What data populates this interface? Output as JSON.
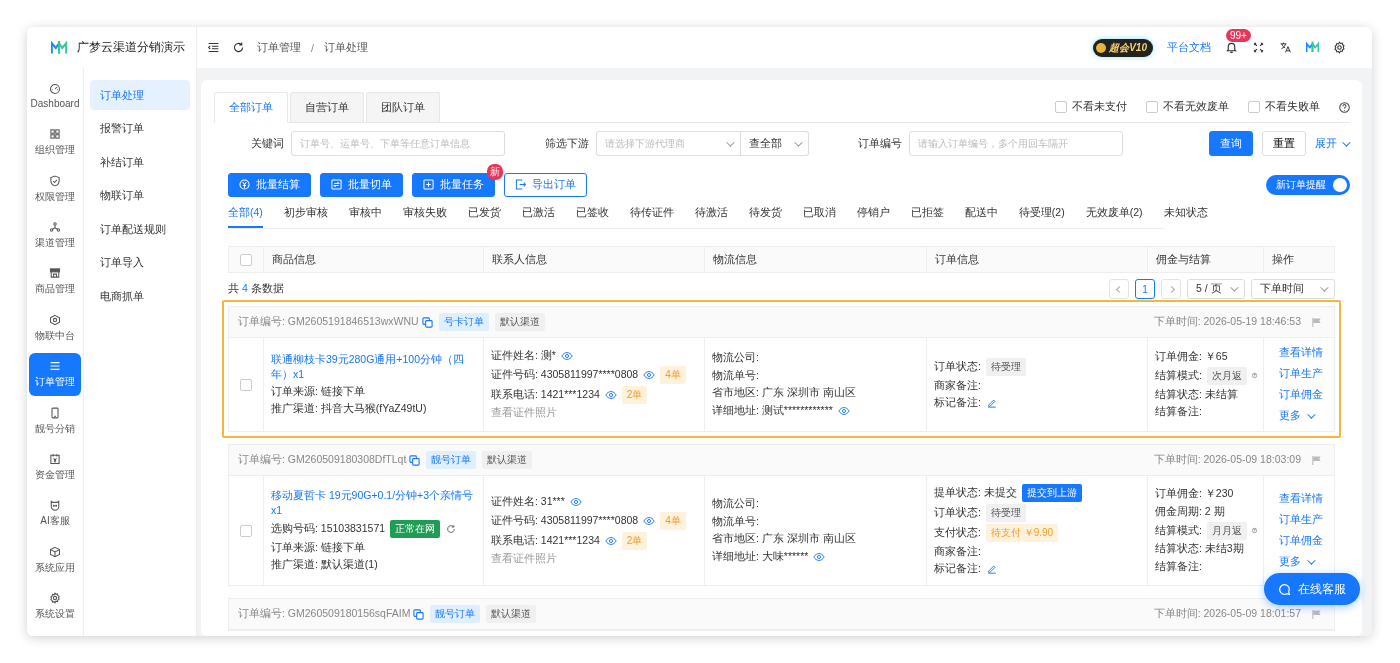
{
  "app": {
    "name": "广梦云渠道分销演示"
  },
  "header": {
    "breadcrumb": [
      "订单管理",
      "订单处理"
    ],
    "breadcrumb_separator": "/",
    "vip_badge": "超会V10",
    "docs_link": "平台文档",
    "notification_count": "99+"
  },
  "rail": [
    {
      "label": "Dashboard",
      "selected": false
    },
    {
      "label": "组织管理",
      "selected": false
    },
    {
      "label": "权限管理",
      "selected": false
    },
    {
      "label": "渠道管理",
      "selected": false
    },
    {
      "label": "商品管理",
      "selected": false
    },
    {
      "label": "物联中台",
      "selected": false
    },
    {
      "label": "订单管理",
      "selected": true
    },
    {
      "label": "靓号分销",
      "selected": false
    },
    {
      "label": "资金管理",
      "selected": false
    },
    {
      "label": "AI客服",
      "selected": false
    },
    {
      "label": "系统应用",
      "selected": false
    },
    {
      "label": "系统设置",
      "selected": false
    }
  ],
  "submenu": [
    {
      "label": "订单处理",
      "selected": true
    },
    {
      "label": "报警订单",
      "selected": false
    },
    {
      "label": "补结订单",
      "selected": false
    },
    {
      "label": "物联订单",
      "selected": false
    },
    {
      "label": "订单配送规则",
      "selected": false
    },
    {
      "label": "订单导入",
      "selected": false
    },
    {
      "label": "电商抓单",
      "selected": false
    }
  ],
  "order_tabs": [
    {
      "label": "全部订单",
      "selected": true
    },
    {
      "label": "自营订单",
      "selected": false
    },
    {
      "label": "团队订单",
      "selected": false
    }
  ],
  "hide_filters": [
    {
      "label": "不看未支付",
      "checked": false
    },
    {
      "label": "不看无效废单",
      "checked": false
    },
    {
      "label": "不看失败单",
      "checked": false
    }
  ],
  "search": {
    "keyword_label": "关键词",
    "keyword_placeholder": "订单号、运单号、下单等任意订单信息",
    "downstream_label": "筛选下游",
    "downstream_placeholder": "请选择下游代理商",
    "scope": "查全部",
    "order_no_label": "订单编号",
    "order_no_placeholder": "请输入订单编号，多个用回车隔开",
    "query": "查询",
    "reset": "重置",
    "expand": "展开"
  },
  "actions": [
    {
      "label": "批量结算",
      "kind": "primary"
    },
    {
      "label": "批量切单",
      "kind": "primary"
    },
    {
      "label": "批量任务",
      "kind": "primary",
      "badge": "新"
    },
    {
      "label": "导出订单",
      "kind": "outline"
    }
  ],
  "new_order_alert": {
    "label": "新订单提醒",
    "on": true
  },
  "status_tabs": [
    {
      "label": "全部(4)",
      "selected": true
    },
    {
      "label": "初步审核",
      "selected": false
    },
    {
      "label": "审核中",
      "selected": false
    },
    {
      "label": "审核失败",
      "selected": false
    },
    {
      "label": "已发货",
      "selected": false
    },
    {
      "label": "已激活",
      "selected": false
    },
    {
      "label": "已签收",
      "selected": false
    },
    {
      "label": "待传证件",
      "selected": false
    },
    {
      "label": "待激活",
      "selected": false
    },
    {
      "label": "待发货",
      "selected": false
    },
    {
      "label": "已取消",
      "selected": false
    },
    {
      "label": "停销户",
      "selected": false
    },
    {
      "label": "已拒签",
      "selected": false
    },
    {
      "label": "配送中",
      "selected": false
    },
    {
      "label": "待受理(2)",
      "selected": false
    },
    {
      "label": "无效废单(2)",
      "selected": false
    },
    {
      "label": "未知状态",
      "selected": false
    }
  ],
  "table": {
    "columns": [
      "商品信息",
      "联系人信息",
      "物流信息",
      "订单信息",
      "佣金与结算",
      "操作"
    ],
    "select_all_checked": false,
    "total_prefix": "共",
    "total_count": "4",
    "total_suffix": "条数据",
    "pages": [
      {
        "label": "1",
        "selected": true
      }
    ],
    "page_size": "5 / 页",
    "sort": "下单时间"
  },
  "orders": [
    {
      "selected": true,
      "checked": false,
      "number": "订单编号: GM2605191846513wxWNU",
      "type_tag": "号卡订单",
      "channel_tag": "默认渠道",
      "time": "下单时间: 2026-05-19 18:46:53",
      "product_title": "联通柳枝卡39元280G通用+100分钟（四年）x1",
      "product_lines": [
        {
          "text": "订单来源: 链接下单"
        },
        {
          "text": "推广渠道: 抖音大马猴(fYaZ49tU)"
        }
      ],
      "contact_lines": [
        {
          "text": "证件姓名: 测*",
          "masked": true
        },
        {
          "text": "证件号码: 4305811997****0808",
          "masked": true,
          "count": "4单"
        },
        {
          "text": "联系电话: 1421***1234",
          "masked": true,
          "count": "2单"
        },
        {
          "text": "查看证件照片",
          "kind": "muted"
        }
      ],
      "logistics_lines": [
        {
          "text": "物流公司:"
        },
        {
          "text": "物流单号:"
        },
        {
          "text": "省市地区: 广东 深圳市 南山区"
        },
        {
          "text": "详细地址: 测试************",
          "masked": true
        }
      ],
      "order_lines": [
        {
          "text": "订单状态:",
          "tag": {
            "text": "待受理",
            "kind": "grey"
          }
        },
        {
          "text": "商家备注:"
        },
        {
          "text": "标记备注:",
          "editable": true
        }
      ],
      "commission_lines": [
        {
          "text": "订单佣金: ￥65"
        },
        {
          "text": "结算模式:",
          "tag": {
            "text": "次月返",
            "kind": "grey"
          },
          "help": true
        },
        {
          "text": "结算状态: 未结算"
        },
        {
          "text": "结算备注:"
        }
      ],
      "operations": [
        "查看详情",
        "订单生产",
        "订单佣金"
      ],
      "more": "更多"
    },
    {
      "selected": false,
      "checked": false,
      "number": "订单编号: GM260509180308DfTLqt",
      "type_tag": "靓号订单",
      "channel_tag": "默认渠道",
      "time": "下单时间: 2026-05-09 18:03:09",
      "product_title": "移动夏哲卡 19元90G+0.1/分钟+3个亲情号 x1",
      "product_lines": [
        {
          "text": "选购号码: 15103831571",
          "tag": {
            "text": "正常在网",
            "kind": "green"
          },
          "refresh": true
        },
        {
          "text": "订单来源: 链接下单"
        },
        {
          "text": "推广渠道: 默认渠道(1)"
        }
      ],
      "contact_lines": [
        {
          "text": "证件姓名: 31***",
          "masked": true
        },
        {
          "text": "证件号码: 4305811997****0808",
          "masked": true,
          "count": "4单"
        },
        {
          "text": "联系电话: 1421***1234",
          "masked": true,
          "count": "2单"
        },
        {
          "text": "查看证件照片",
          "kind": "muted"
        }
      ],
      "logistics_lines": [
        {
          "text": "物流公司:"
        },
        {
          "text": "物流单号:"
        },
        {
          "text": "省市地区: 广东 深圳市 南山区"
        },
        {
          "text": "详细地址: 大味******",
          "masked": true
        }
      ],
      "order_lines": [
        {
          "text": "提单状态: 未提交",
          "tag": {
            "text": "提交到上游",
            "kind": "blue"
          }
        },
        {
          "text": "订单状态:",
          "tag": {
            "text": "待受理",
            "kind": "grey"
          }
        },
        {
          "text": "支付状态:",
          "tag": {
            "text": "待支付 ￥9.90",
            "kind": "orange"
          }
        },
        {
          "text": "商家备注:"
        },
        {
          "text": "标记备注:",
          "editable": true
        }
      ],
      "commission_lines": [
        {
          "text": "订单佣金: ￥230"
        },
        {
          "text": "佣金周期: 2 期"
        },
        {
          "text": "结算模式:",
          "tag": {
            "text": "月月返",
            "kind": "grey"
          },
          "help": true
        },
        {
          "text": "结算状态: 未结3期"
        },
        {
          "text": "结算备注:"
        }
      ],
      "operations": [
        "查看详情",
        "订单生产",
        "订单佣金"
      ],
      "more": "更多"
    },
    {
      "selected": false,
      "number": "订单编号: GM260509180156sqFAIM",
      "type_tag": "靓号订单",
      "channel_tag": "默认渠道",
      "time": "下单时间: 2026-05-09 18:01:57"
    }
  ],
  "support_button": "在线客服"
}
